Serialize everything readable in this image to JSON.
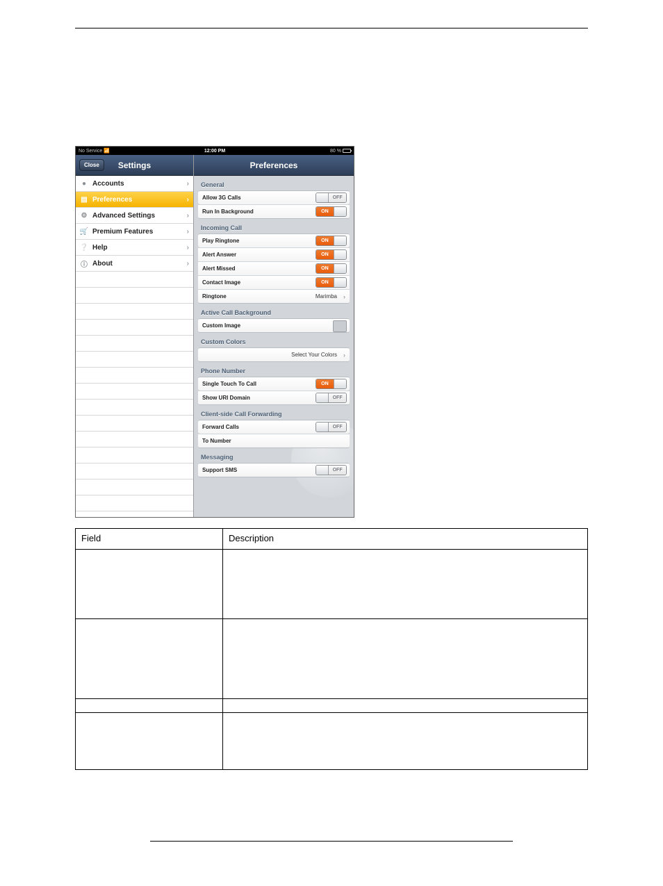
{
  "statusbar": {
    "carrier": "No Service",
    "wifi_icon": "wifi",
    "time": "12:00 PM",
    "battery_pct": "80 %"
  },
  "left": {
    "title": "Settings",
    "close": "Close",
    "items": [
      {
        "icon": "user",
        "label": "Accounts",
        "selected": false
      },
      {
        "icon": "sliders",
        "label": "Preferences",
        "selected": true
      },
      {
        "icon": "gears",
        "label": "Advanced Settings",
        "selected": false
      },
      {
        "icon": "cart",
        "label": "Premium Features",
        "selected": false
      },
      {
        "icon": "question",
        "label": "Help",
        "selected": false
      },
      {
        "icon": "info",
        "label": "About",
        "selected": false
      }
    ]
  },
  "right": {
    "title": "Preferences",
    "sections": {
      "general": {
        "header": "General",
        "allow3g": {
          "label": "Allow 3G Calls",
          "value": "OFF"
        },
        "bg": {
          "label": "Run In Background",
          "value": "ON"
        }
      },
      "incoming": {
        "header": "Incoming Call",
        "play": {
          "label": "Play Ringtone",
          "value": "ON"
        },
        "answer": {
          "label": "Alert Answer",
          "value": "ON"
        },
        "missed": {
          "label": "Alert Missed",
          "value": "ON"
        },
        "contact": {
          "label": "Contact Image",
          "value": "ON"
        },
        "ringtone": {
          "label": "Ringtone",
          "value": "Marimba"
        }
      },
      "activebg": {
        "header": "Active Call Background",
        "custom": {
          "label": "Custom Image"
        }
      },
      "colors": {
        "header": "Custom Colors",
        "select": {
          "label": "Select Your Colors"
        }
      },
      "phone": {
        "header": "Phone Number",
        "single": {
          "label": "Single Touch To Call",
          "value": "ON"
        },
        "uri": {
          "label": "Show URI Domain",
          "value": "OFF"
        }
      },
      "fwd": {
        "header": "Client-side Call Forwarding",
        "forward": {
          "label": "Forward Calls",
          "value": "OFF"
        },
        "tonum": {
          "label": "To Number"
        }
      },
      "msg": {
        "header": "Messaging",
        "sms": {
          "label": "Support SMS",
          "value": "OFF"
        }
      }
    }
  },
  "table": {
    "r0c0": "Field",
    "r0c1": "Description",
    "r1c0": "",
    "r1c1": "",
    "r2c0": "",
    "r2c1": "",
    "r3c0": "",
    "r3c1": "",
    "r4c0": "",
    "r4c1": ""
  }
}
